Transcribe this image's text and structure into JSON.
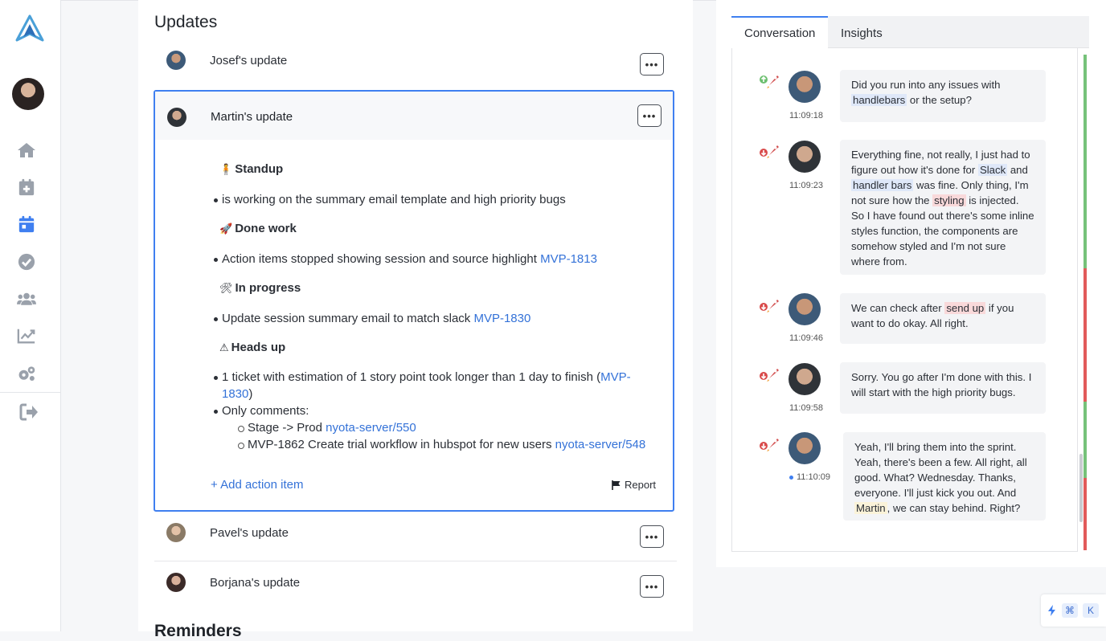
{
  "main": {
    "updates_heading": "Updates",
    "reminders_heading": "Reminders",
    "rows": [
      {
        "name": "Josef's update"
      },
      {
        "name": "Martin's update"
      },
      {
        "name": "Pavel's update"
      },
      {
        "name": "Borjana's update"
      }
    ],
    "menu_button_label": "•••",
    "expanded": {
      "sections": [
        {
          "emoji": "🧍",
          "title": "Standup",
          "items": [
            {
              "text": "is working on the summary email template and high priority bugs"
            }
          ]
        },
        {
          "emoji": "🚀",
          "title": "Done work",
          "items": [
            {
              "text": "Action items stopped showing session and source highlight ",
              "link": "MVP-1813"
            }
          ]
        },
        {
          "emoji": "🛠",
          "title": "In progress",
          "items": [
            {
              "text": "Update session summary email to match slack ",
              "link": "MVP-1830"
            }
          ]
        },
        {
          "emoji": "⚠",
          "title": "Heads up",
          "items": [
            {
              "text_line1": "1 ticket with estimation of 1 story point took longer than 1 day to finish (",
              "link_line1": "MVP-",
              "link_line2": "1830",
              "text_line2": ")"
            },
            {
              "text": "Only comments:"
            }
          ],
          "sub_items": [
            {
              "text": "Stage -> Prod ",
              "link": "nyota-server/550"
            },
            {
              "text": "MVP-1862 Create trial workflow in hubspot for new users ",
              "link": "nyota-server/548"
            }
          ]
        }
      ],
      "add_action_label": "+ Add action item",
      "report_label": "Report"
    }
  },
  "panel": {
    "tabs": [
      {
        "label": "Conversation",
        "active": true
      },
      {
        "label": "Insights",
        "active": false
      }
    ],
    "messages": [
      {
        "time": "11:09:18",
        "parts": [
          "Did you run into any issues with ",
          {
            "hl": "blue",
            "t": "handlebars"
          },
          " or the setup?"
        ]
      },
      {
        "time": "11:09:23",
        "parts": [
          "Everything fine, not really, I just had to figure out how it's done for ",
          {
            "hl": "blue",
            "t": "Slack"
          },
          " and ",
          {
            "hl": "blue",
            "t": "handler bars"
          },
          " was fine. Only thing, I'm not sure how the ",
          {
            "hl": "red",
            "t": "styling"
          },
          " is injected. So I have found out there's some inline styles function, the components are somehow styled and I'm not sure where from."
        ]
      },
      {
        "time": "11:09:46",
        "parts": [
          "We can check after ",
          {
            "hl": "red",
            "t": "send up"
          },
          " if you want to do okay. All right."
        ]
      },
      {
        "time": "11:09:58",
        "parts": [
          "Sorry. You go after I'm done with this. I will start with the high priority bugs."
        ]
      },
      {
        "time": "11:10:09",
        "parts": [
          "Yeah, I'll bring them into the sprint. Yeah, there's been a few. All right, all good. What? Wednesday. Thanks, everyone. I'll just kick you out. And ",
          {
            "hl": "yellow",
            "t": "Martin"
          },
          ", we can stay behind. Right?"
        ]
      }
    ]
  },
  "shortcut": {
    "key1": "⌘",
    "key2": "K"
  },
  "icons": {
    "sidebar": [
      "home-icon",
      "calendar-plus-icon",
      "calendar-icon",
      "check-circle-icon",
      "users-icon",
      "chart-line-icon",
      "gears-icon",
      "sign-out-icon"
    ]
  },
  "colors": {
    "accent": "#3f7ff0",
    "link": "#3472d8",
    "positive": "#76c27a",
    "negative": "#e25a5a"
  }
}
